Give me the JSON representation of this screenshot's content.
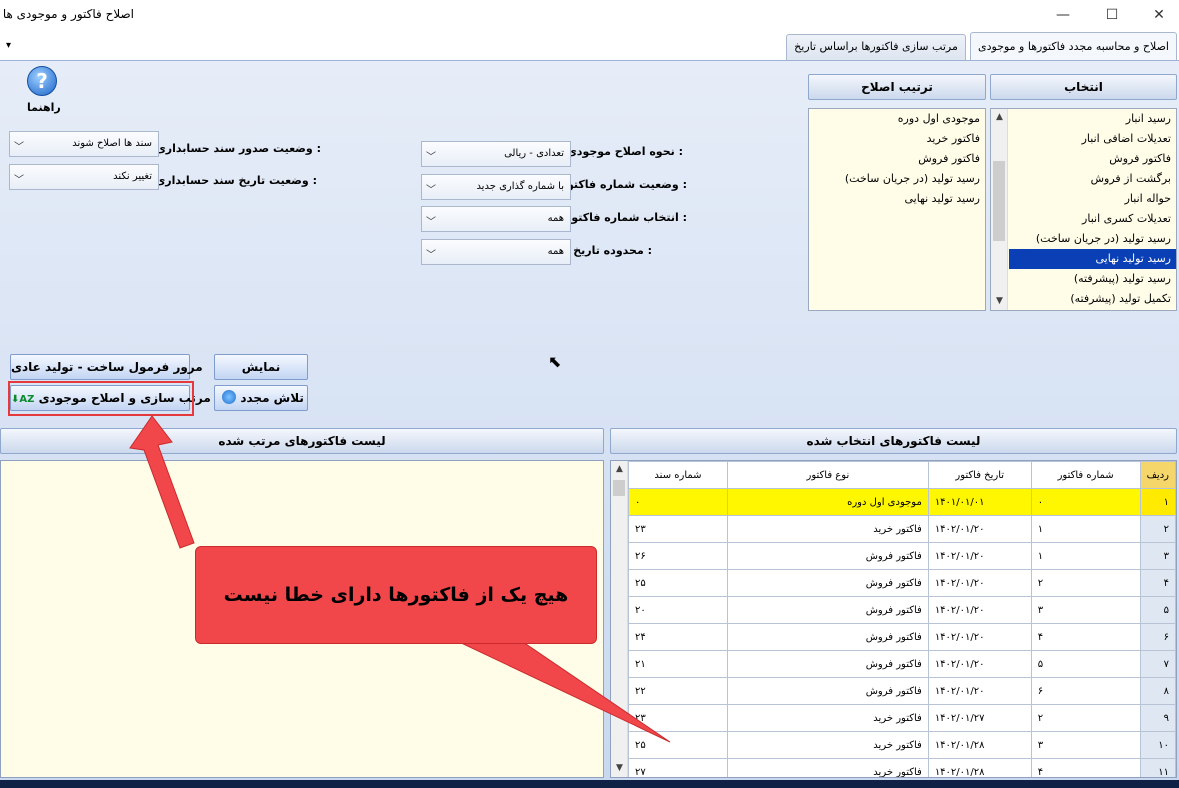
{
  "window": {
    "title": "اصلاح فاکتور و موجودی ها",
    "minimize": "—",
    "maximize": "☐",
    "close": "✕"
  },
  "tabs": [
    {
      "label": "اصلاح و محاسبه مجدد فاکتورها و موجودی"
    },
    {
      "label": "مرتب سازی فاکتورها براساس تاریخ"
    }
  ],
  "tab_menu_glyph": "▾",
  "help": {
    "label": "راهنما",
    "glyph": "?"
  },
  "selection": {
    "header": "انتخاب",
    "items": [
      "رسید انبار",
      "تعدیلات اضافی انبار",
      "فاکتور فروش",
      "برگشت از فروش",
      "حواله انبار",
      "تعدیلات کسری انبار",
      "رسید تولید (در جریان ساخت)",
      "رسید تولید نهایی",
      "رسید تولید (پیشرفته)",
      "تکمیل تولید (پیشرفته)"
    ],
    "selected_index": 7
  },
  "order": {
    "header": "ترتیب اصلاح",
    "items": [
      "موجودی اول دوره",
      "فاکتور خرید",
      "فاکتور فروش",
      "رسید تولید (در جریان ساخت)",
      "رسید تولید نهایی"
    ]
  },
  "fields": {
    "inventory_method": {
      "label": "نحوه اصلاح موجودی :",
      "value": "تعدادی - ریالی"
    },
    "invoice_number_status": {
      "label": "وضعیت شماره فاکتور :",
      "value": "با شماره گذاری جدید"
    },
    "invoice_number_select": {
      "label": "انتخاب شماره فاکتور :",
      "value": "همه"
    },
    "date_range": {
      "label": "محدوده تاریخ :",
      "value": "همه"
    },
    "doc_issue_status": {
      "label": "وضعیت صدور سند حسابداری :",
      "value": "سند ها اصلاح شوند"
    },
    "doc_date_status": {
      "label": "وضعیت تاریخ سند حسابداری :",
      "value": "تغییر نکند"
    }
  },
  "buttons": {
    "show": "نمایش",
    "retry": "تلاش مجدد",
    "review_formula": "مرور فرمول ساخت - تولید عادی",
    "sort_fix": "مرتب سازی و اصلاح موجودی"
  },
  "sorted_header": "لیست فاکتورهای مرتب شده",
  "selected_header": "لیست فاکتورهای انتخاب شده",
  "grid": {
    "columns": [
      "ردیف",
      "شماره فاکتور",
      "تاریخ فاکتور",
      "نوع فاکتور",
      "شماره سند"
    ],
    "rows": [
      [
        "۱",
        "۰",
        "۱۴۰۱/۰۱/۰۱",
        "موجودی اول دوره",
        "۰"
      ],
      [
        "۲",
        "۱",
        "۱۴۰۲/۰۱/۲۰",
        "فاکتور خرید",
        "۲۳"
      ],
      [
        "۳",
        "۱",
        "۱۴۰۲/۰۱/۲۰",
        "فاکتور فروش",
        "۲۶"
      ],
      [
        "۴",
        "۲",
        "۱۴۰۲/۰۱/۲۰",
        "فاکتور فروش",
        "۲۵"
      ],
      [
        "۵",
        "۳",
        "۱۴۰۲/۰۱/۲۰",
        "فاکتور فروش",
        "۲۰"
      ],
      [
        "۶",
        "۴",
        "۱۴۰۲/۰۱/۲۰",
        "فاکتور فروش",
        "۲۴"
      ],
      [
        "۷",
        "۵",
        "۱۴۰۲/۰۱/۲۰",
        "فاکتور فروش",
        "۲۱"
      ],
      [
        "۸",
        "۶",
        "۱۴۰۲/۰۱/۲۰",
        "فاکتور فروش",
        "۲۲"
      ],
      [
        "۹",
        "۲",
        "۱۴۰۲/۰۱/۲۷",
        "فاکتور خرید",
        "۲۳"
      ],
      [
        "۱۰",
        "۳",
        "۱۴۰۲/۰۱/۲۸",
        "فاکتور خرید",
        "۲۵"
      ],
      [
        "۱۱",
        "۴",
        "۱۴۰۲/۰۱/۲۸",
        "فاکتور خرید",
        "۲۷"
      ]
    ]
  },
  "callout": {
    "text": "هیچ یک از فاکتورها دارای خطا نیست"
  },
  "colors": {
    "accent": "#0a3fb5",
    "callout": "#f2474a",
    "highlight_row": "#fff700"
  }
}
